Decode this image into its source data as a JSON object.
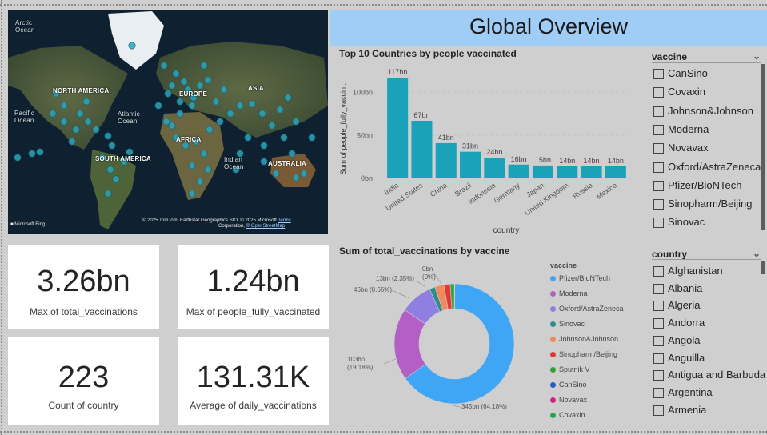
{
  "page": {
    "title": "Global Overview"
  },
  "map": {
    "labels": {
      "arctic": "Arctic\nOcean",
      "north_america": "NORTH AMERICA",
      "europe": "EUROPE",
      "asia": "ASIA",
      "pacific": "Pacific\nOcean",
      "atlantic": "Atlantic\nOcean",
      "africa": "AFRICA",
      "south_america": "SOUTH AMERICA",
      "indian": "Indian\nOcean",
      "australia": "AUSTRALIA"
    },
    "brand": "Microsoft Bing",
    "credit": "© 2025 TomTom, Earthstar Geographics SIO, © 2025 Microsoft",
    "credit2": "Corporation,",
    "osm": "© OpenStreetMap",
    "terms": "Terms",
    "marker_color": "#2ea3b8"
  },
  "cards": [
    {
      "value": "3.26bn",
      "label": "Max of total_vaccinations"
    },
    {
      "value": "1.24bn",
      "label": "Max of people_fully_vaccinated"
    },
    {
      "value": "223",
      "label": "Count of country"
    },
    {
      "value": "131.31K",
      "label": "Average of daily_vaccinations"
    }
  ],
  "bar_chart": {
    "title": "Top 10 Countries by people vaccinated"
  },
  "donut_chart": {
    "title": "Sum of total_vaccinations by vaccine"
  },
  "chart_data": [
    {
      "type": "bar",
      "title": "Top 10 Countries by people vaccinated",
      "xlabel": "country",
      "ylabel": "Sum of people_fully_vaccin...",
      "categories": [
        "India",
        "United States",
        "China",
        "Brazil",
        "Indonesia",
        "Germany",
        "Japan",
        "United Kingdom",
        "Russia",
        "Mexico"
      ],
      "values": [
        117,
        67,
        41,
        31,
        24,
        16,
        15,
        14,
        14,
        14
      ],
      "data_labels": [
        "117bn",
        "67bn",
        "41bn",
        "31bn",
        "24bn",
        "16bn",
        "15bn",
        "14bn",
        "14bn",
        "14bn"
      ],
      "yticks": [
        "0bn",
        "50bn",
        "100bn"
      ],
      "ylim": [
        0,
        120
      ],
      "unit": "bn",
      "color": "#1aa3b8",
      "grid": true
    },
    {
      "type": "pie",
      "title": "Sum of total_vaccinations by vaccine",
      "legend_title": "vaccine",
      "legend_position": "right",
      "slices": [
        {
          "name": "Pfizer/BioNTech",
          "value": 345,
          "pct": 64.18,
          "color": "#3fa6f5",
          "label": "345bn (64.18%)"
        },
        {
          "name": "Moderna",
          "value": 103,
          "pct": 19.18,
          "color": "#b45fc6",
          "label": "103bn (19.18%)"
        },
        {
          "name": "Oxford/AstraZeneca",
          "value": 46,
          "pct": 8.65,
          "color": "#8e7fe0",
          "label": "46bn (8.65%)"
        },
        {
          "name": "Sinovac",
          "value": 8,
          "pct": 1.5,
          "color": "#2f8c8c",
          "label": ""
        },
        {
          "name": "Johnson&Johnson",
          "value": 13,
          "pct": 2.35,
          "color": "#f08a5d",
          "label": "13bn (2.35%)"
        },
        {
          "name": "Sinopharm/Beijing",
          "value": 9,
          "pct": 1.7,
          "color": "#e03838",
          "label": ""
        },
        {
          "name": "Sputnik V",
          "value": 6,
          "pct": 1.1,
          "color": "#2fa33a",
          "label": ""
        },
        {
          "name": "CanSino",
          "value": 0.3,
          "pct": 0.06,
          "color": "#1f5fc0",
          "label": ""
        },
        {
          "name": "Novavax",
          "value": 0.2,
          "pct": 0.04,
          "color": "#d0267a",
          "label": ""
        },
        {
          "name": "Covaxin",
          "value": 0.1,
          "pct": 0,
          "color": "#27a844",
          "label": "0bn (0%)"
        }
      ]
    }
  ],
  "slicers": {
    "vaccine": {
      "label": "vaccine",
      "items": [
        "CanSino",
        "Covaxin",
        "Johnson&Johnson",
        "Moderna",
        "Novavax",
        "Oxford/AstraZeneca",
        "Pfizer/BioNTech",
        "Sinopharm/Beijing",
        "Sinovac"
      ]
    },
    "country": {
      "label": "country",
      "items": [
        "Afghanistan",
        "Albania",
        "Algeria",
        "Andorra",
        "Angola",
        "Anguilla",
        "Antigua and Barbuda",
        "Argentina",
        "Armenia"
      ]
    }
  }
}
